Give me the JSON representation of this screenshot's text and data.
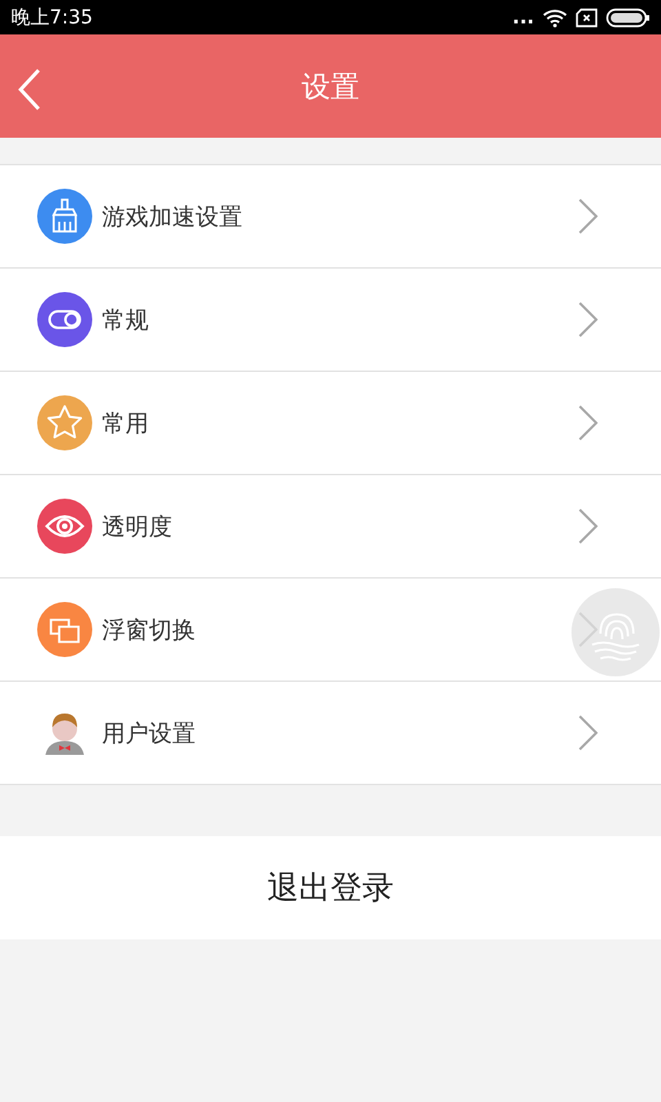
{
  "status_bar": {
    "time": "晚上7:35",
    "dots": "..."
  },
  "header": {
    "title": "设置"
  },
  "items": [
    {
      "label": "游戏加速设置",
      "kind": "brush",
      "color": "#3d8cf0"
    },
    {
      "label": "常规",
      "kind": "toggle",
      "color": "#6a55e8"
    },
    {
      "label": "常用",
      "kind": "star",
      "color": "#eda64e"
    },
    {
      "label": "透明度",
      "kind": "eye",
      "color": "#e8475c"
    },
    {
      "label": "浮窗切换",
      "kind": "windows",
      "color": "#f98642"
    },
    {
      "label": "用户设置",
      "kind": "avatar"
    }
  ],
  "logout": {
    "label": "退出登录"
  }
}
